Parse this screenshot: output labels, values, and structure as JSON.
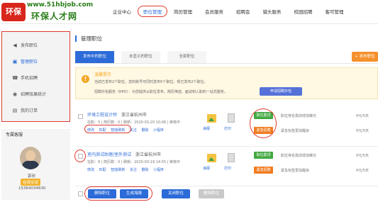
{
  "brand": {
    "mark": "环保",
    "url": "www.51hbjob.com",
    "name": "环保人才网"
  },
  "nav": {
    "items": [
      "企业中心",
      "职位管理",
      "简历管理",
      "会员服务",
      "招聘会",
      "猎头服务",
      "校园招聘",
      "客可管理"
    ]
  },
  "sidebar": {
    "items": [
      {
        "icon": "◀",
        "label": "发布职位"
      },
      {
        "icon": "▣",
        "label": "管理职位"
      },
      {
        "icon": "☎",
        "label": "手机招聘"
      },
      {
        "icon": "◉",
        "label": "招聘效果统计"
      },
      {
        "icon": "▤",
        "label": "我的订单"
      }
    ]
  },
  "profile": {
    "title": "专属客服",
    "name": "郭欣",
    "qq": "在线交谈",
    "phone": "15364034630"
  },
  "main": {
    "title": "管理职位",
    "tabs": [
      "发布中的职位",
      "未显示的职位",
      "全部职位"
    ],
    "post_button": "+ 发布职位",
    "notice": {
      "title": "温馨提示",
      "line1": "当前已发布2个职位，您的账号可同时发布5个职位，现已发布2个职位。",
      "line2": "招聘外包服务（RPO）：为您提供从职位发布、简历筛选、面试到入职的一站式服务。",
      "button": "申请招聘外包"
    },
    "jobs": [
      {
        "title": "环境工程设计师",
        "location": "浙江省杭州市",
        "meta": "在职：5 | 简历数：0 | 刷新：2020-03-20 10:06 | 审核中",
        "actions": [
          "修改",
          "匹配",
          "智能刷新",
          "关注",
          "删除",
          "小程序"
        ],
        "poster": "海报",
        "print": "打印",
        "tag_top": "职位置顶",
        "tag_urgent": "紧急招聘",
        "desc_top": "职位排名靠前增加曝光",
        "desc_urgent": "紧急标签更加醒目",
        "price": "¥元/5天"
      },
      {
        "title": "室内测试助理/室外测试",
        "location": "浙江省杭州市",
        "meta": "在职：8 | 简历数：0 | 刷新：2020-03-19 14:55 | 审核中",
        "actions": [
          "修改",
          "匹配",
          "智能刷新",
          "关注",
          "删除",
          "小程序"
        ],
        "poster": "海报",
        "print": "打印",
        "tag_top": "职位置顶",
        "tag_urgent": "紧急招聘",
        "desc_top": "职位排名靠前增加曝光",
        "desc_urgent": "紧急标签更加醒目",
        "price": "¥元/5天"
      }
    ],
    "bottom": {
      "delete": "删除职位",
      "poster": "生成海报",
      "close": "关闭职位",
      "remove": "删除职位"
    }
  },
  "colors": {
    "accent": "#2c6bd8",
    "highlight": "#e03a2f",
    "green": "#42a942",
    "orange": "#f07d22",
    "brand": "#2a7d1a"
  }
}
